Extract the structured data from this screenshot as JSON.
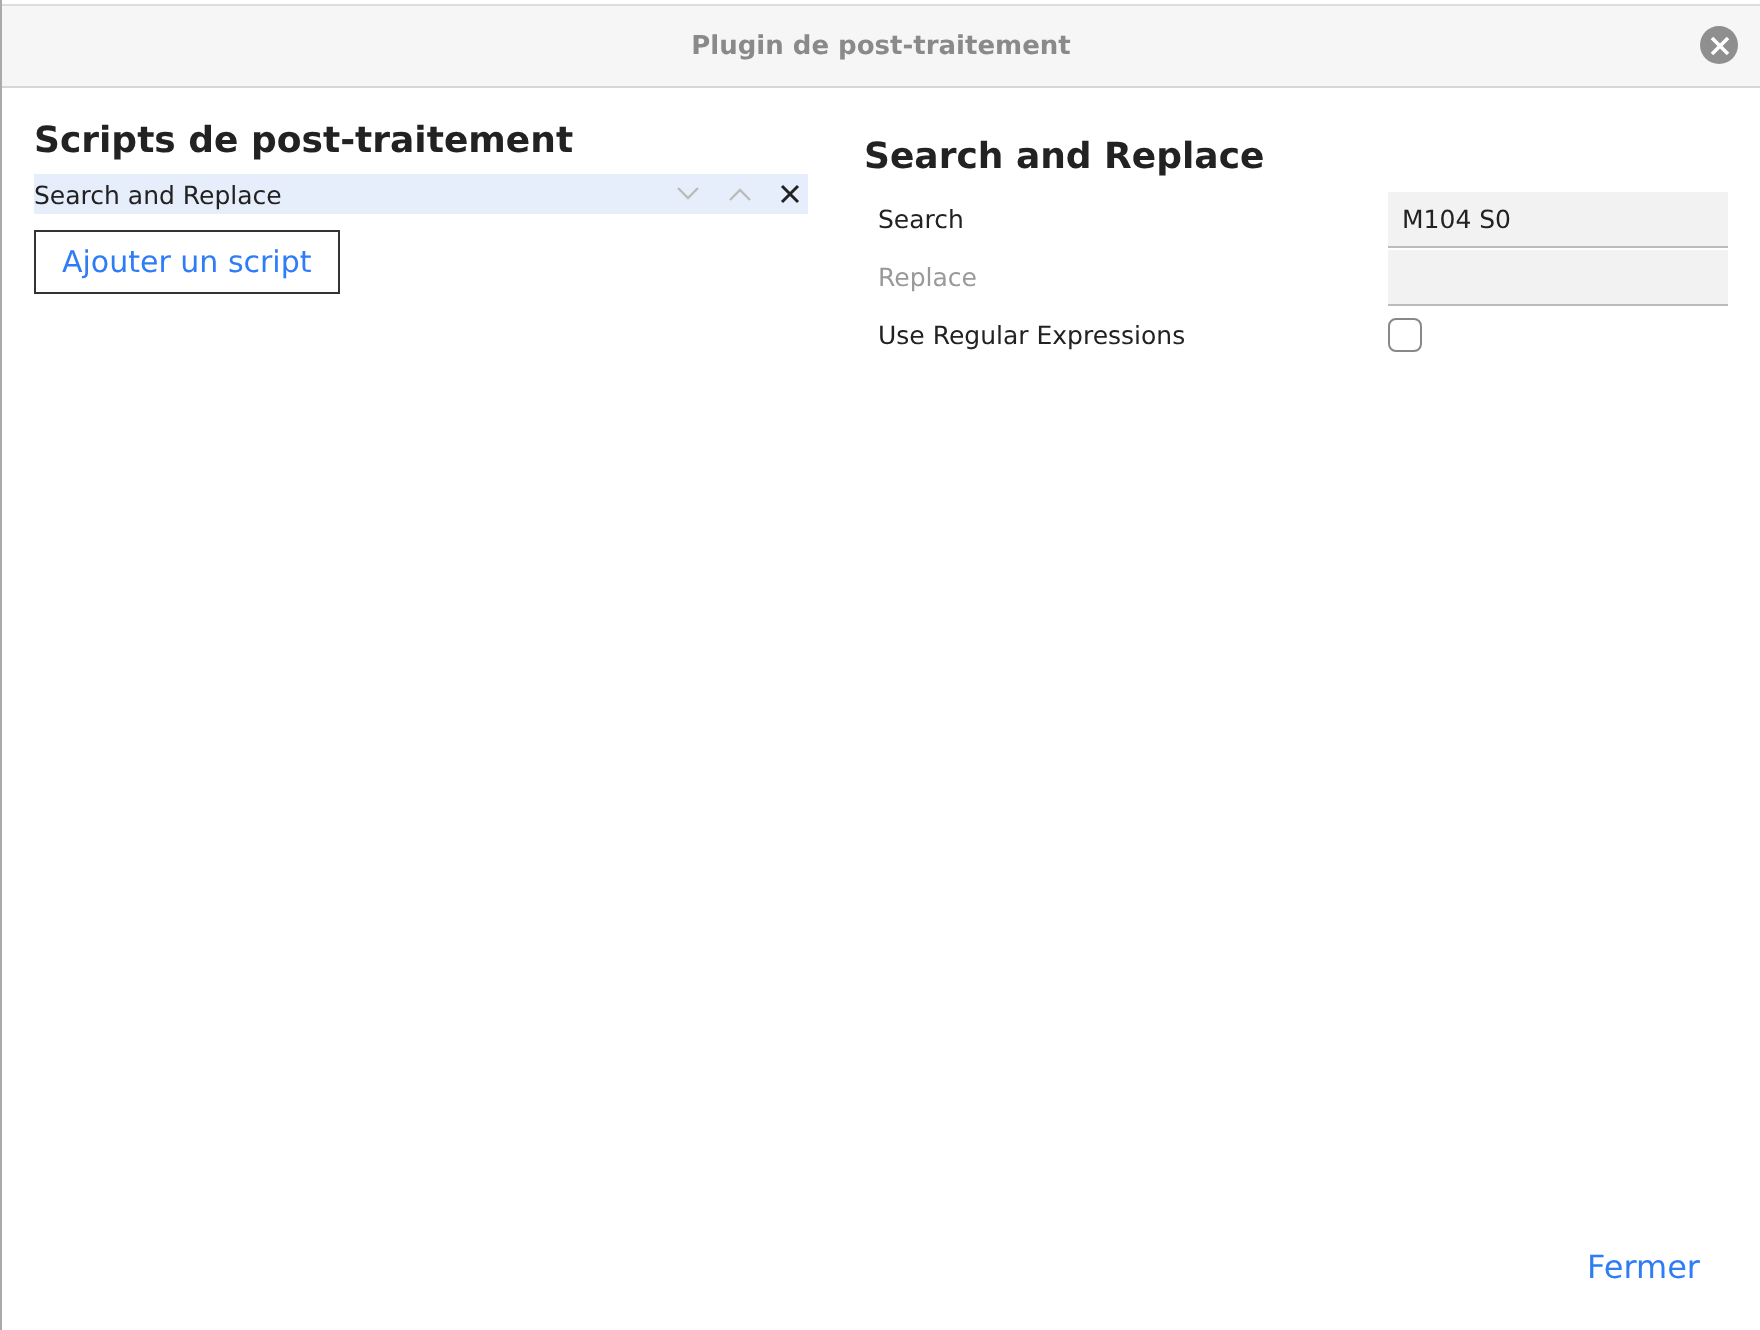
{
  "window": {
    "title": "Plugin de post-traitement"
  },
  "scripts_panel": {
    "heading": "Scripts de post-traitement",
    "scripts": [
      {
        "name": "Search and Replace",
        "selected": true
      }
    ],
    "add_button": "Ajouter un script"
  },
  "settings_panel": {
    "heading": "Search and Replace",
    "settings": [
      {
        "kind": "text",
        "label": "Search",
        "value": "M104 S0",
        "disabled": false
      },
      {
        "kind": "text",
        "label": "Replace",
        "disabled": true
      },
      {
        "kind": "checkbox",
        "label": "Use Regular Expressions",
        "checked": false,
        "disabled": false
      }
    ]
  },
  "close_button": "Fermer"
}
